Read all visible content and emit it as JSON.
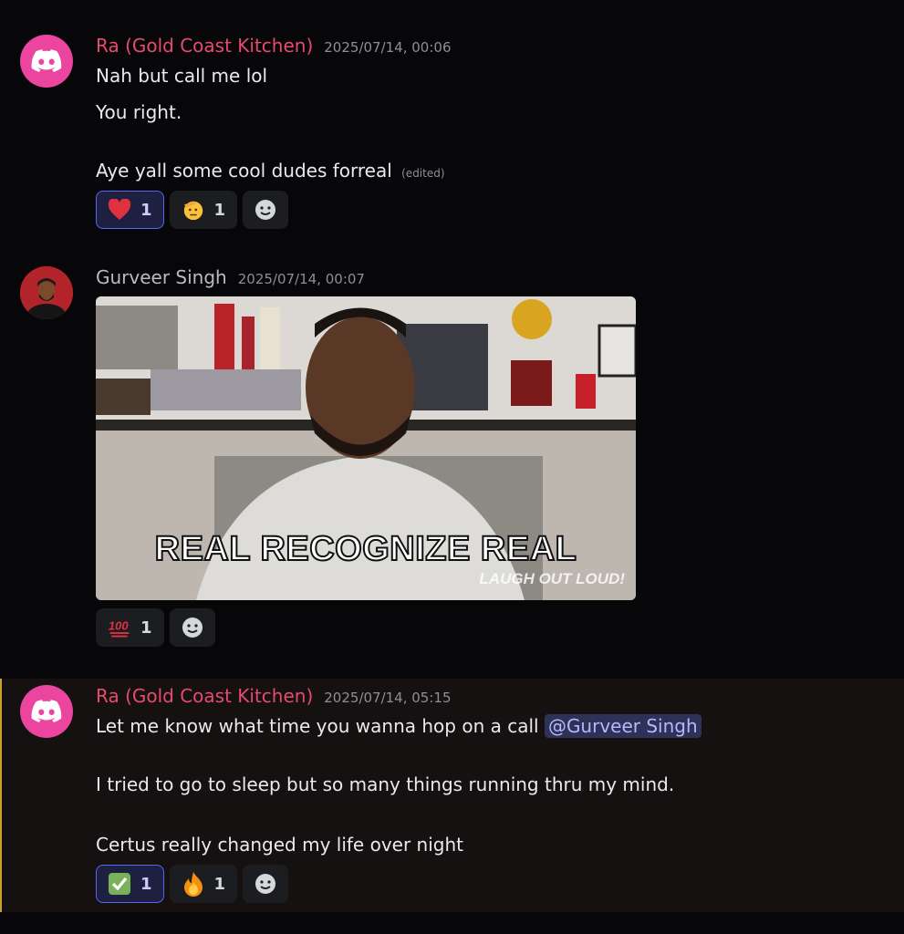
{
  "messages": [
    {
      "author": "Ra (Gold Coast Kitchen)",
      "timestamp": "2025/07/14, 00:06",
      "lines": [
        "Nah but call me lol",
        "You right.",
        "Aye yall some cool dudes forreal"
      ],
      "edited_label": "(edited)",
      "reactions": [
        {
          "emoji": "heart",
          "count": "1",
          "me": true
        },
        {
          "emoji": "saluting-face",
          "count": "1",
          "me": false
        }
      ]
    },
    {
      "author": "Gurveer Singh",
      "timestamp": "2025/07/14, 00:07",
      "gif": {
        "caption": "REAL RECOGNIZE REAL",
        "watermark": "LAUGH OUT LOUD!"
      },
      "reactions": [
        {
          "emoji": "hundred-points",
          "count": "1",
          "me": false
        }
      ]
    },
    {
      "author": "Ra (Gold Coast Kitchen)",
      "timestamp": "2025/07/14, 05:15",
      "lines": [
        "Let me know what time you wanna hop on a call ",
        "I tried to go to sleep but so many things running thru my mind.",
        "Certus really changed my life over night"
      ],
      "mention": "@Gurveer Singh",
      "reactions": [
        {
          "emoji": "check-mark",
          "count": "1",
          "me": true
        },
        {
          "emoji": "fire",
          "count": "1",
          "me": false
        }
      ]
    }
  ],
  "colors": {
    "author_pink": "#e84a6e",
    "mention_bg": "#2e3257",
    "blurple": "#5865f2"
  }
}
